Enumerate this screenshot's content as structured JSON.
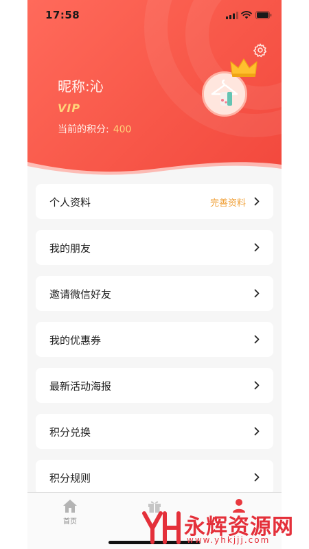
{
  "status_bar": {
    "time": "17:58"
  },
  "profile": {
    "nickname": "昵称:沁",
    "vip_label": "VIP",
    "points_label": "当前的积分:",
    "points_value": "400"
  },
  "icons": {
    "settings": "gear-icon",
    "chevron": "chevron-right-icon",
    "home": "home-icon",
    "gift": "gift-icon",
    "profile": "person-icon"
  },
  "menu": [
    {
      "label": "个人资料",
      "hint": "完善资料"
    },
    {
      "label": "我的朋友"
    },
    {
      "label": "邀请微信好友"
    },
    {
      "label": "我的优惠券"
    },
    {
      "label": "最新活动海报"
    },
    {
      "label": "积分兑换"
    },
    {
      "label": "积分规则"
    }
  ],
  "tabbar": {
    "home_label": "首页"
  },
  "watermark": {
    "title": "永辉资源网",
    "url": "www.yhkjjj.com"
  },
  "colors": {
    "header": "#f95b4c",
    "accent": "#ffd37a",
    "hint": "#f0a13a",
    "watermark": "#e4303a"
  }
}
